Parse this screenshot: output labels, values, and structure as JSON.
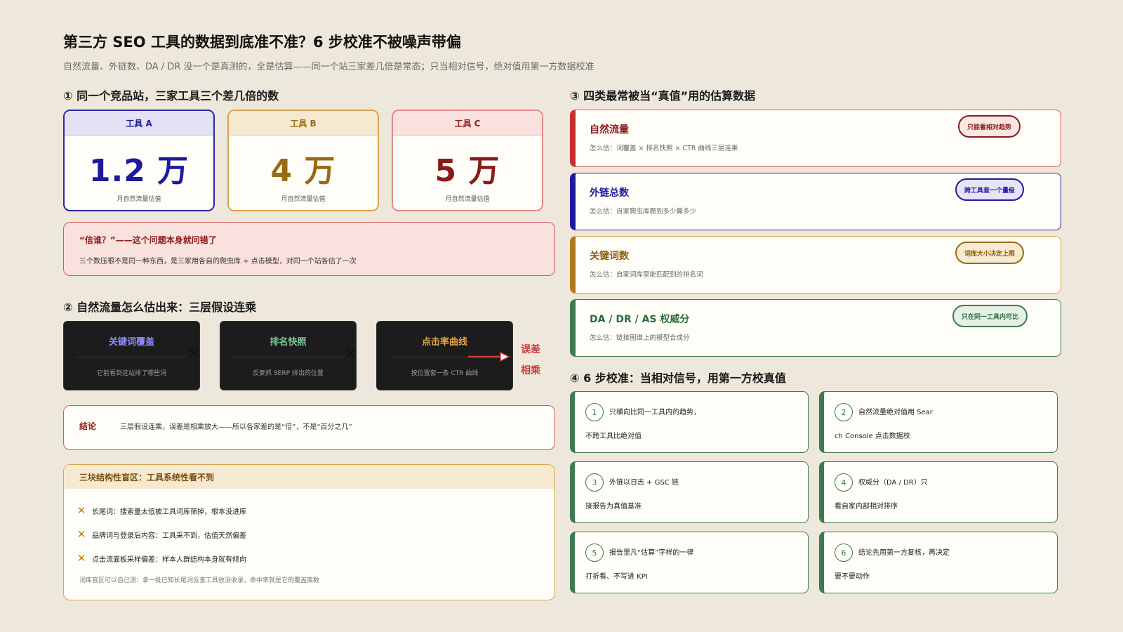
{
  "title": "第三方 SEO 工具的数据到底准不准？6 步校准不被噪声带偏",
  "subtitle": "自然流量、外链数、DA / DR 没一个是真测的，全是估算——同一个站三家差几倍是常态；只当相对信号，绝对值用第一方数据校准",
  "section1": {
    "heading": "① 同一个竞品站，三家工具三个差几倍的数",
    "tools": [
      {
        "name": "工具 A",
        "value": "1.2 万",
        "caption": "月自然流量估值"
      },
      {
        "name": "工具 B",
        "value": "4 万",
        "caption": "月自然流量估值"
      },
      {
        "name": "工具 C",
        "value": "5 万",
        "caption": "月自然流量估值"
      }
    ],
    "callout_heading": "“信谁？”——这个问题本身就问错了",
    "callout_body": "三个数压根不是同一种东西，是三家用各自的爬虫库 + 点击模型，对同一个站各估了一次"
  },
  "section2": {
    "heading": "② 自然流量怎么估出来：三层假设连乘",
    "layers": [
      {
        "title": "关键词覆盖",
        "desc": "它能看到这站排了哪些词"
      },
      {
        "title": "排名快照",
        "desc": "反复抓 SERP 拼出的位置"
      },
      {
        "title": "点击率曲线",
        "desc": "按位置套一条 CTR 曲线"
      }
    ],
    "error_label_1": "误差",
    "error_label_2": "相乘",
    "conclusion_label": "结论",
    "conclusion_text": "三层假设连乘，误差是相乘放大——所以各家差的是“倍”，不是“百分之几”"
  },
  "blindspots": {
    "heading": "三块结构性盲区：工具系统性看不到",
    "items": [
      "长尾词：搜索量太低被工具词库筛掉，根本没进库",
      "品牌词与登录后内容：工具采不到，估值天然偏差",
      "点击流面板采样偏差：样本人群结构本身就有倾向"
    ],
    "note": "词库盲区可以自己测：拿一批已知长尾词反查工具收没收录，命中率就是它的覆盖底数"
  },
  "section3": {
    "heading": "③ 四类最常被当“真值”用的估算数据",
    "metrics": [
      {
        "title": "自然流量",
        "desc": "怎么估：词覆盖 × 排名快照 × CTR 曲线三层连乘",
        "tag": "只能看相对趋势"
      },
      {
        "title": "外链总数",
        "desc": "怎么估：自家爬虫库爬到多少算多少",
        "tag": "跨工具差一个量级"
      },
      {
        "title": "关键词数",
        "desc": "怎么估：自家词库里能匹配到的排名词",
        "tag": "词库大小决定上限"
      },
      {
        "title": "DA / DR / AS 权威分",
        "desc": "怎么估：链接图谱上的模型合成分",
        "tag": "只在同一工具内可比"
      }
    ]
  },
  "section4": {
    "heading": "④ 6 步校准：当相对信号，用第一方校真值",
    "steps": [
      {
        "num": "1",
        "line1": "只横向比同一工具内的趋势，",
        "line2": "不跨工具比绝对值"
      },
      {
        "num": "2",
        "line1": "自然流量绝对值用 Sear",
        "line2": "ch Console 点击数据校"
      },
      {
        "num": "3",
        "line1": "外链以日志 + GSC 链",
        "line2": "接报告为真值基准"
      },
      {
        "num": "4",
        "line1": "权威分（DA / DR）只",
        "line2": "看自家内部相对排序"
      },
      {
        "num": "5",
        "line1": "报告里凡“估算”字样的一律",
        "line2": "打折看、不写进 KPI"
      },
      {
        "num": "6",
        "line1": "结论先用第一方复核，再决定",
        "line2": "要不要动作"
      }
    ]
  },
  "colors": {
    "blue": "#1e1a9c",
    "gold": "#9a6a12",
    "red": "#8a1b1b",
    "green": "#3d7a4f"
  }
}
